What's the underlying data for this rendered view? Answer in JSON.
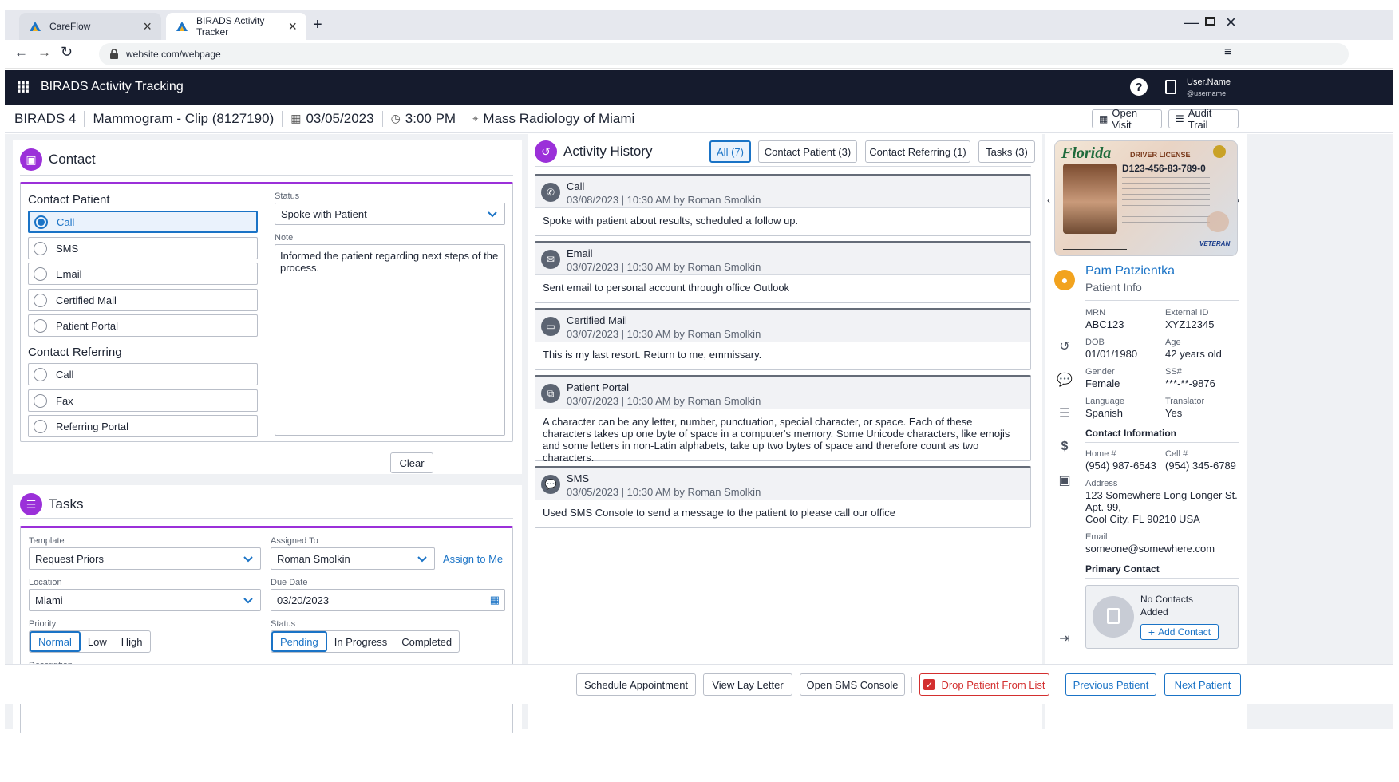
{
  "browser": {
    "tabs": [
      {
        "label": "CareFlow"
      },
      {
        "label": "BIRADS Activity Tracker"
      }
    ],
    "url": "website.com/webpage"
  },
  "app": {
    "title": "BIRADS Activity Tracking",
    "user_name": "User.Name",
    "user_handle": "@username"
  },
  "context": {
    "birads": "BIRADS 4",
    "exam": "Mammogram - Clip (8127190)",
    "date": "03/05/2023",
    "time": "3:00 PM",
    "location": "Mass Radiology of Miami",
    "open_visit": "Open Visit",
    "audit_trail": "Audit Trail"
  },
  "contact": {
    "title": "Contact",
    "patient_heading": "Contact Patient",
    "patient_options": [
      "Call",
      "SMS",
      "Email",
      "Certified Mail",
      "Patient Portal"
    ],
    "patient_selected": "Call",
    "referring_heading": "Contact Referring",
    "referring_options": [
      "Call",
      "Fax",
      "Referring Portal"
    ],
    "status_label": "Status",
    "status_value": "Spoke with Patient",
    "note_label": "Note",
    "note_value": "Informed the patient regarding next steps of the process.",
    "clear": "Clear"
  },
  "tasks": {
    "title": "Tasks",
    "template_label": "Template",
    "template_value": "Request Priors",
    "assigned_label": "Assigned To",
    "assigned_value": "Roman Smolkin",
    "assign_me": "Assign to Me",
    "location_label": "Location",
    "location_value": "Miami",
    "due_label": "Due Date",
    "due_value": "03/20/2023",
    "priority_label": "Priority",
    "priority_options": [
      "Normal",
      "Low",
      "High"
    ],
    "priority_selected": "Normal",
    "status_label": "Status",
    "status_options": [
      "Pending",
      "In Progress",
      "Completed"
    ],
    "status_selected": "Pending",
    "description_label": "Description"
  },
  "activity": {
    "title": "Activity History",
    "filters": [
      "All (7)",
      "Contact Patient (3)",
      "Contact Referring (1)",
      "Tasks (3)"
    ],
    "active_filter": "All (7)",
    "items": [
      {
        "icon": "phone-icon",
        "title": "Call",
        "meta": "03/08/2023 | 10:30 AM by Roman Smolkin",
        "body": "Spoke with patient about results, scheduled a follow up."
      },
      {
        "icon": "email-icon",
        "title": "Email",
        "meta": "03/07/2023 | 10:30 AM by Roman Smolkin",
        "body": "Sent email to personal account through office Outlook"
      },
      {
        "icon": "mail-icon",
        "title": "Certified Mail",
        "meta": "03/07/2023 | 10:30 AM by Roman Smolkin",
        "body": "This is my last resort. Return to me, emmissary."
      },
      {
        "icon": "portal-icon",
        "title": "Patient Portal",
        "meta": "03/07/2023 | 10:30 AM by Roman Smolkin",
        "body": "A character can be any letter, number, punctuation, special character, or space. Each of these characters takes up one byte of space in a computer's memory. Some Unicode characters, like emojis and some letters in non-Latin alphabets, take up two bytes of space and therefore count as two characters."
      },
      {
        "icon": "sms-icon",
        "title": "SMS",
        "meta": "03/05/2023 | 10:30 AM by Roman Smolkin",
        "body": "Used SMS Console to send a message to the patient to please call our office"
      }
    ]
  },
  "patient": {
    "license": {
      "state": "Florida",
      "type": "DRIVER LICENSE",
      "number": "D123-456-83-789-0",
      "veteran": "VETERAN"
    },
    "name": "Pam Patzientka",
    "subtitle": "Patient Info",
    "mrn_label": "MRN",
    "mrn": "ABC123",
    "ext_label": "External ID",
    "ext": "XYZ12345",
    "dob_label": "DOB",
    "dob": "01/01/1980",
    "age_label": "Age",
    "age": "42 years old",
    "gender_label": "Gender",
    "gender": "Female",
    "ss_label": "SS#",
    "ss": "***-**-9876",
    "lang_label": "Language",
    "lang": "Spanish",
    "trans_label": "Translator",
    "trans": "Yes",
    "contact_heading": "Contact Information",
    "home_label": "Home #",
    "home": "(954) 987-6543",
    "cell_label": "Cell #",
    "cell": "(954) 345-6789",
    "address_label": "Address",
    "address1": "123 Somewhere Long Longer St.",
    "address2": "Apt. 99,",
    "address3": "Cool City, FL 90210 USA",
    "email_label": "Email",
    "email": "someone@somewhere.com",
    "primary_heading": "Primary Contact",
    "no_contacts_1": "No Contacts",
    "no_contacts_2": "Added",
    "add_contact": "Add Contact"
  },
  "footer": {
    "schedule": "Schedule Appointment",
    "lay_letter": "View Lay Letter",
    "sms_console": "Open SMS Console",
    "drop": "Drop Patient From List",
    "previous": "Previous Patient",
    "next": "Next Patient"
  },
  "colors": {
    "accent": "#1a73c6",
    "purple": "#9b30d9",
    "header": "#151b2d",
    "danger": "#d32f2f"
  }
}
